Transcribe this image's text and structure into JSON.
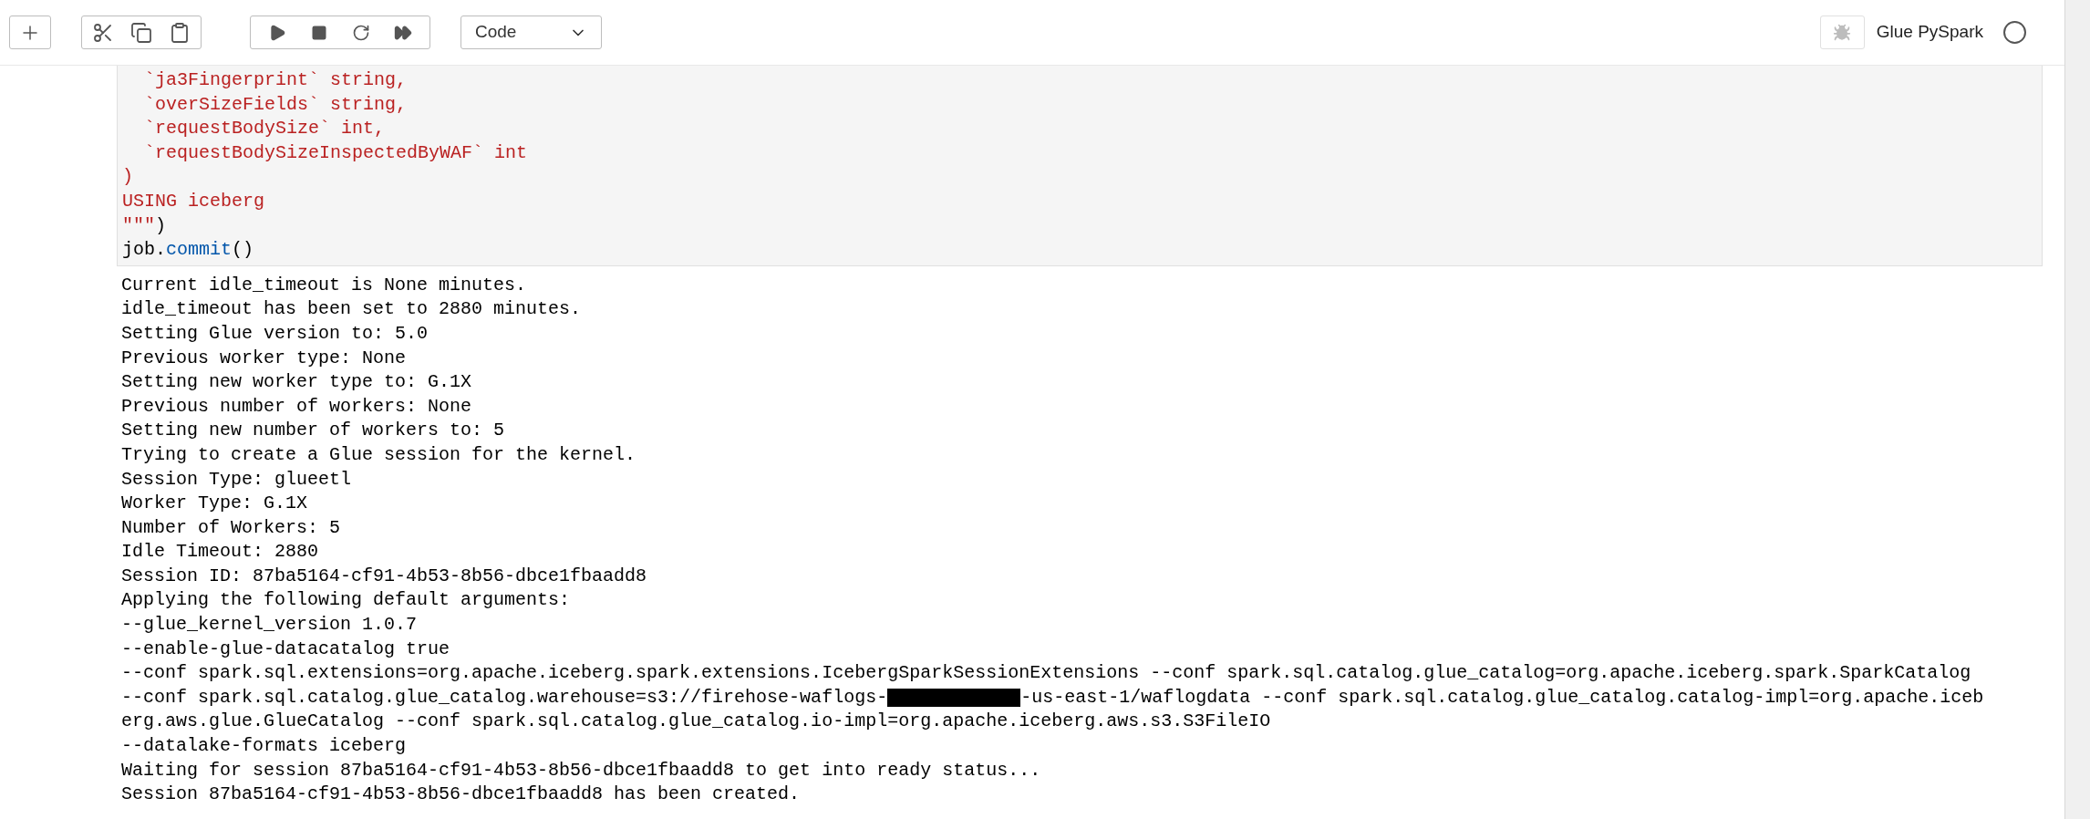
{
  "toolbar": {
    "cell_type": "Code"
  },
  "kernel": {
    "name": "Glue PySpark",
    "busy": false
  },
  "cell": {
    "code": [
      [
        {
          "kind": "string",
          "text": "  `ja3Fingerprint` string,"
        }
      ],
      [
        {
          "kind": "string",
          "text": "  `overSizeFields` string,"
        }
      ],
      [
        {
          "kind": "string",
          "text": "  `requestBodySize` int,"
        }
      ],
      [
        {
          "kind": "string",
          "text": "  `requestBodySizeInspectedByWAF` int"
        }
      ],
      [
        {
          "kind": "string",
          "text": ")"
        }
      ],
      [
        {
          "kind": "string",
          "text": "USING iceberg"
        }
      ],
      [
        {
          "kind": "string",
          "text": "\"\"\""
        },
        {
          "kind": "plain",
          "text": ")"
        }
      ],
      [
        {
          "kind": "plain",
          "text": "job."
        },
        {
          "kind": "name",
          "text": "commit"
        },
        {
          "kind": "plain",
          "text": "()"
        }
      ]
    ],
    "output": [
      "Current idle_timeout is None minutes.",
      "idle_timeout has been set to 2880 minutes.",
      "Setting Glue version to: 5.0",
      "Previous worker type: None",
      "Setting new worker type to: G.1X",
      "Previous number of workers: None",
      "Setting new number of workers to: 5",
      "Trying to create a Glue session for the kernel.",
      "Session Type: glueetl",
      "Worker Type: G.1X",
      "Number of Workers: 5",
      "Idle Timeout: 2880",
      "Session ID: 87ba5164-cf91-4b53-8b56-dbce1fbaadd8",
      "Applying the following default arguments:",
      "--glue_kernel_version 1.0.7",
      "--enable-glue-datacatalog true",
      "--conf spark.sql.extensions=org.apache.iceberg.spark.extensions.IcebergSparkSessionExtensions --conf spark.sql.catalog.glue_catalog=org.apache.iceberg.spark.SparkCatalog",
      {
        "parts": [
          {
            "kind": "text",
            "text": "--conf spark.sql.catalog.glue_catalog.warehouse=s3://firehose-waflogs-"
          },
          {
            "kind": "redacted"
          },
          {
            "kind": "text",
            "text": "-us-east-1/waflogdata --conf spark.sql.catalog.glue_catalog.catalog-impl=org.apache.iceb"
          }
        ]
      },
      "erg.aws.glue.GlueCatalog --conf spark.sql.catalog.glue_catalog.io-impl=org.apache.iceberg.aws.s3.S3FileIO",
      "--datalake-formats iceberg",
      "Waiting for session 87ba5164-cf91-4b53-8b56-dbce1fbaadd8 to get into ready status...",
      "Session 87ba5164-cf91-4b53-8b56-dbce1fbaadd8 has been created."
    ]
  }
}
